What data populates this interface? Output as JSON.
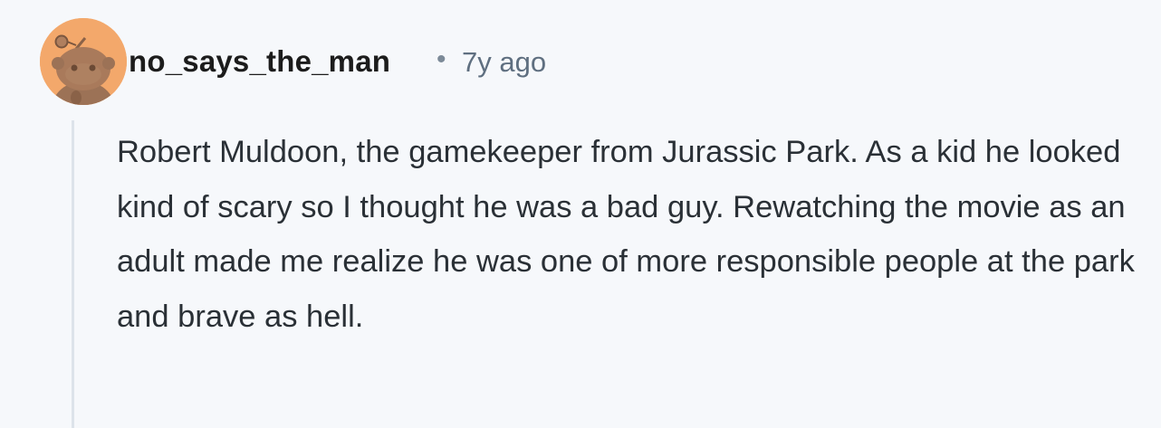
{
  "comment": {
    "author": "no_says_the_man",
    "separator": "•",
    "timestamp": "7y ago",
    "avatar_icon": "snoo-avatar-icon",
    "avatar_bg": "#f3a86b",
    "body": "Robert Muldoon, the gamekeeper from Jurassic Park. As a kid he looked kind of scary so I thought he was a bad guy. Rewatching the movie as an adult made me realize he was one of more responsible people at the park and brave as hell."
  }
}
